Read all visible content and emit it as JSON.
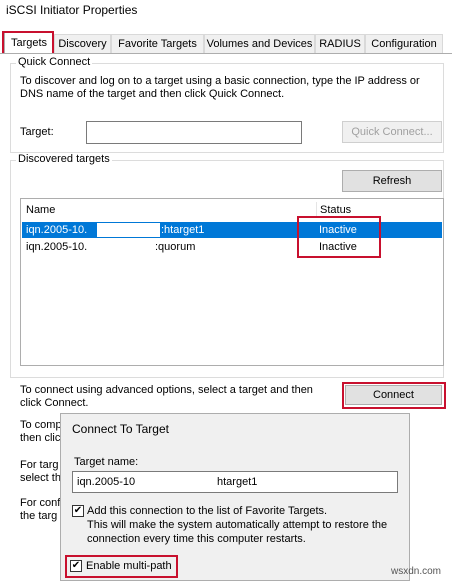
{
  "window": {
    "title": "iSCSI Initiator Properties"
  },
  "tabs": [
    {
      "label": "Targets"
    },
    {
      "label": "Discovery"
    },
    {
      "label": "Favorite Targets"
    },
    {
      "label": "Volumes and Devices"
    },
    {
      "label": "RADIUS"
    },
    {
      "label": "Configuration"
    }
  ],
  "quick_connect": {
    "group_label": "Quick Connect",
    "description_line1": "To discover and log on to a target using a basic connection, type the IP address or",
    "description_line2": "DNS name of the target and then click Quick Connect.",
    "target_label": "Target:",
    "target_value": "",
    "button_label": "Quick Connect..."
  },
  "discovered": {
    "group_label": "Discovered targets",
    "refresh_label": "Refresh",
    "columns": {
      "name": "Name",
      "status": "Status"
    },
    "rows": [
      {
        "name_prefix": "iqn.2005-10.",
        "name_suffix": ":htarget1",
        "status": "Inactive"
      },
      {
        "name_prefix": "iqn.2005-10.",
        "name_suffix": ":quorum",
        "status": "Inactive"
      }
    ]
  },
  "advanced": {
    "text_line1": "To connect using advanced options, select a target and then",
    "text_line2": "click Connect.",
    "connect_label": "Connect"
  },
  "partial_text": {
    "p1_line1": "To comp",
    "p1_line2": "then clic",
    "p2_line1": "For targ",
    "p2_line2": "select th",
    "p3_line1": "For conf",
    "p3_line2": "the targ"
  },
  "dialog": {
    "title": "Connect To Target",
    "target_name_label": "Target name:",
    "target_name_prefix": "iqn.2005-10",
    "target_name_suffix": "htarget1",
    "favorite_label": "Add this connection to the list of Favorite Targets.",
    "favorite_checked": true,
    "favorite_note_line1": "This will make the system automatically attempt to restore the",
    "favorite_note_line2": "connection every time this computer restarts.",
    "multipath_label": "Enable multi-path",
    "multipath_checked": true,
    "check_glyph": "✔"
  },
  "watermark": "wsxdn.com",
  "colors": {
    "selection": "#0078d7",
    "highlight_box": "#c8102e"
  }
}
